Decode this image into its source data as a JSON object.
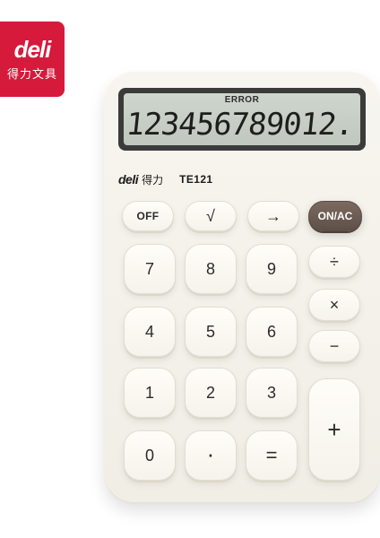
{
  "brand_badge": {
    "word": "deli",
    "cn": "得力文具"
  },
  "calculator": {
    "display": {
      "status": "ERROR",
      "digits": "123456789012."
    },
    "label": {
      "brand": "deli",
      "cn": "得力",
      "model": "TE121"
    },
    "keys": {
      "off": "OFF",
      "sqrt": "√",
      "arrow": "→",
      "on_ac": "ON/AC",
      "k7": "7",
      "k8": "8",
      "k9": "9",
      "div": "÷",
      "mul": "×",
      "k4": "4",
      "k5": "5",
      "k6": "6",
      "minus": "−",
      "k1": "1",
      "k2": "2",
      "k3": "3",
      "plus": "+",
      "k0": "0",
      "dot": "·",
      "equals": "="
    }
  },
  "colors": {
    "brand_red": "#d51a3b",
    "on_key": "#6b5b52",
    "body": "#f3f1ea"
  }
}
